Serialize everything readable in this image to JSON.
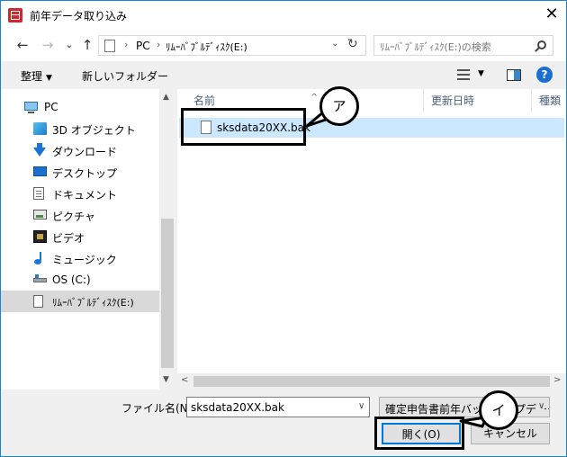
{
  "window": {
    "title": "前年データ取り込み",
    "close_glyph": "✕"
  },
  "address": {
    "back": "←",
    "forward": "→",
    "recent": "⌄",
    "up": "↑",
    "sep": "›",
    "crumbs": [
      "PC",
      "ﾘﾑｰﾊﾞﾌﾞﾙﾃﾞｨｽｸ(E:)"
    ],
    "dropdown": "⌄",
    "refresh": "↻",
    "search_placeholder": "ﾘﾑｰﾊﾞﾌﾞﾙﾃﾞｨｽｸ(E:)の検索"
  },
  "toolbar": {
    "organize": "整理",
    "caret": "▼",
    "new_folder": "新しいフォルダー",
    "view_caret": "▼",
    "help": "?"
  },
  "nav": {
    "items": [
      {
        "label": "PC",
        "icon": "pc-icon"
      },
      {
        "label": "3D オブジェクト",
        "icon": "3d-objects-icon"
      },
      {
        "label": "ダウンロード",
        "icon": "download-icon"
      },
      {
        "label": "デスクトップ",
        "icon": "desktop-icon"
      },
      {
        "label": "ドキュメント",
        "icon": "documents-icon"
      },
      {
        "label": "ピクチャ",
        "icon": "pictures-icon"
      },
      {
        "label": "ビデオ",
        "icon": "videos-icon"
      },
      {
        "label": "ミュージック",
        "icon": "music-icon"
      },
      {
        "label": "OS (C:)",
        "icon": "os-drive-icon"
      },
      {
        "label": "ﾘﾑｰﾊﾞﾌﾞﾙﾃﾞｨｽｸ(E:)",
        "icon": "removable-disk-icon"
      }
    ],
    "scroll_up": "▲",
    "scroll_down": "▼"
  },
  "file_list": {
    "columns": [
      "名前",
      "更新日時",
      "種類"
    ],
    "sort_arrow": "^",
    "files": [
      {
        "name": "sksdata20XX.bak"
      }
    ],
    "scroll_left": "<",
    "scroll_right": ">"
  },
  "bottom": {
    "filename_label": "ファイル名(N):",
    "filename_value": "sksdata20XX.bak",
    "filename_caret": "∨",
    "filetype_value": "確定申告書前年バックアップデータ",
    "filetype_caret": "∨",
    "open_label": "開く(O)",
    "cancel_label": "キャンセル"
  },
  "callouts": {
    "a": "ア",
    "b": "イ"
  }
}
